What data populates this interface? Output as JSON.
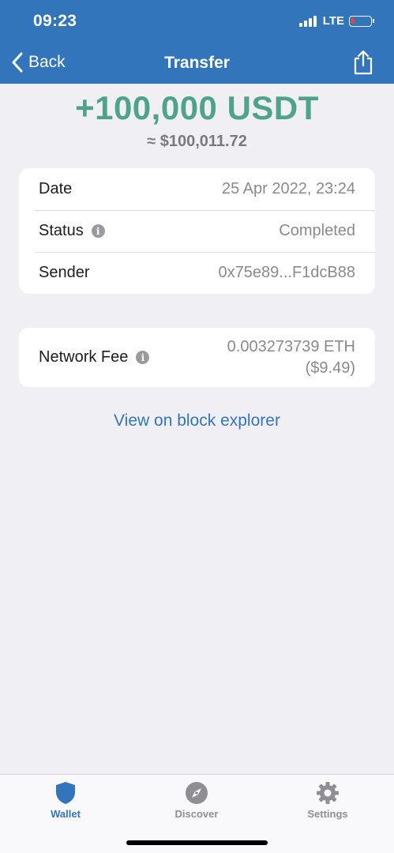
{
  "status_bar": {
    "time": "09:23",
    "network": "LTE"
  },
  "nav": {
    "back_label": "Back",
    "title": "Transfer"
  },
  "transaction": {
    "amount": "+100,000 USDT",
    "fiat_value": "≈ $100,011.72"
  },
  "details": {
    "date_label": "Date",
    "date_value": "25 Apr 2022, 23:24",
    "status_label": "Status",
    "status_value": "Completed",
    "sender_label": "Sender",
    "sender_value": "0x75e89...F1dcB88"
  },
  "fee": {
    "label": "Network Fee",
    "value_crypto": "0.003273739 ETH",
    "value_fiat": "($9.49)"
  },
  "explorer_link": "View on block explorer",
  "tabs": [
    {
      "label": "Wallet",
      "icon": "shield-icon",
      "active": true
    },
    {
      "label": "Discover",
      "icon": "compass-icon",
      "active": false
    },
    {
      "label": "Settings",
      "icon": "gear-icon",
      "active": false
    }
  ],
  "colors": {
    "brand_blue": "#3375bb",
    "amount_green": "#4ea38a",
    "background": "#efeff4"
  }
}
